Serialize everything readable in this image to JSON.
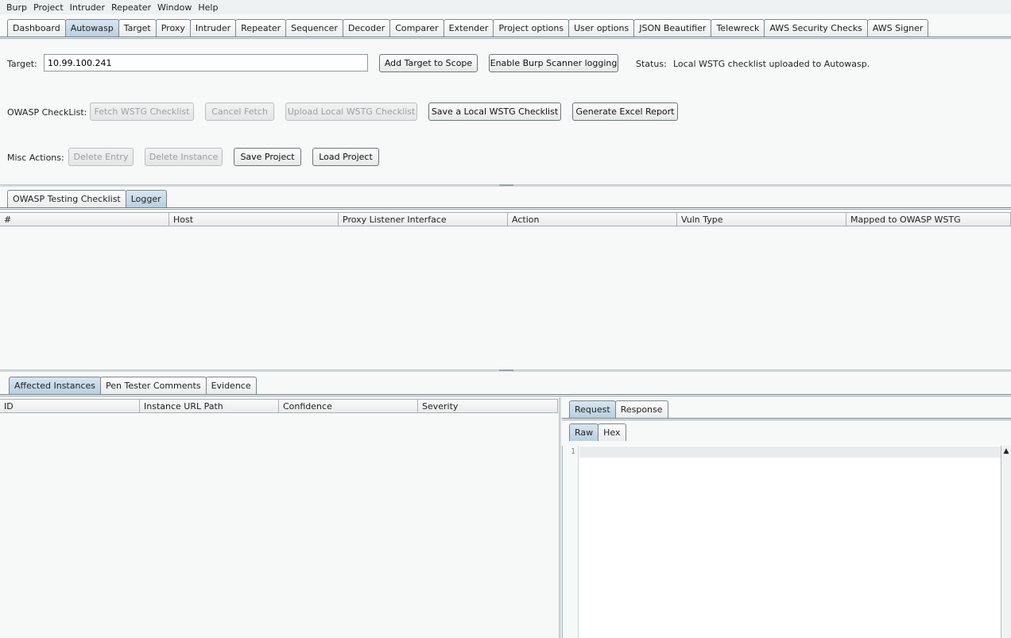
{
  "menubar": [
    "Burp",
    "Project",
    "Intruder",
    "Repeater",
    "Window",
    "Help"
  ],
  "main_tabs": [
    {
      "label": "Dashboard",
      "active": false
    },
    {
      "label": "Autowasp",
      "active": true
    },
    {
      "label": "Target",
      "active": false
    },
    {
      "label": "Proxy",
      "active": false
    },
    {
      "label": "Intruder",
      "active": false
    },
    {
      "label": "Repeater",
      "active": false
    },
    {
      "label": "Sequencer",
      "active": false
    },
    {
      "label": "Decoder",
      "active": false
    },
    {
      "label": "Comparer",
      "active": false
    },
    {
      "label": "Extender",
      "active": false
    },
    {
      "label": "Project options",
      "active": false
    },
    {
      "label": "User options",
      "active": false
    },
    {
      "label": "JSON Beautifier",
      "active": false
    },
    {
      "label": "Telewreck",
      "active": false
    },
    {
      "label": "AWS Security Checks",
      "active": false
    },
    {
      "label": "AWS Signer",
      "active": false
    }
  ],
  "target": {
    "label": "Target:",
    "value": "10.99.100.241",
    "add_scope_label": "Add Target to Scope",
    "enable_logging_label": "Enable Burp Scanner logging",
    "status_label": "Status:",
    "status_text": "Local WSTG checklist uploaded to Autowasp."
  },
  "checklist": {
    "label": "OWASP CheckList:",
    "fetch_label": "Fetch WSTG Checklist",
    "cancel_label": "Cancel Fetch",
    "upload_label": "Upload Local WSTG Checklist",
    "save_local_label": "Save a Local WSTG Checklist",
    "excel_label": "Generate Excel Report"
  },
  "misc": {
    "label": "Misc Actions:",
    "delete_entry_label": "Delete Entry",
    "delete_instance_label": "Delete Instance",
    "save_project_label": "Save Project",
    "load_project_label": "Load Project"
  },
  "sub_tabs": [
    {
      "label": "OWASP Testing Checklist",
      "active": false
    },
    {
      "label": "Logger",
      "active": true
    }
  ],
  "logger_columns": [
    "#",
    "Host",
    "Proxy Listener Interface",
    "Action",
    "Vuln Type",
    "Mapped to OWASP WSTG"
  ],
  "lower_tabs": [
    {
      "label": "Affected Instances",
      "active": true
    },
    {
      "label": "Pen Tester Comments",
      "active": false
    },
    {
      "label": "Evidence",
      "active": false
    }
  ],
  "instance_columns": [
    "ID",
    "Instance URL Path",
    "Confidence",
    "Severity"
  ],
  "reqres_tabs": [
    {
      "label": "Request",
      "active": true
    },
    {
      "label": "Response",
      "active": false
    }
  ],
  "view_tabs": [
    {
      "label": "Raw",
      "active": true
    },
    {
      "label": "Hex",
      "active": false
    }
  ],
  "editor": {
    "line_number": "1"
  }
}
